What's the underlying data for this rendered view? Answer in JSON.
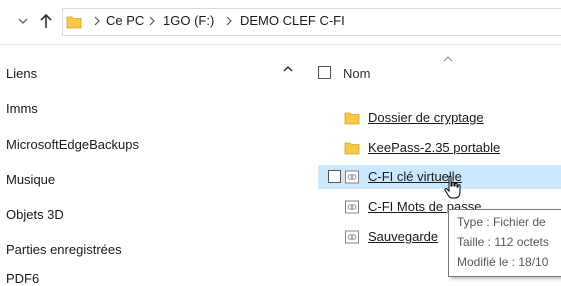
{
  "address": {
    "icons": [
      "chevron-down-icon",
      "up-arrow-icon",
      "folder-icon"
    ],
    "crumbs": [
      "Ce PC",
      "1GO (F:)",
      "DEMO CLEF C-FI"
    ]
  },
  "nav": {
    "items": [
      "Liens",
      "Imms",
      "MicrosoftEdgeBackups",
      "Musique",
      "Objets 3D",
      "Parties enregistrées",
      "PDF6"
    ]
  },
  "list": {
    "header": "Nom",
    "rows": [
      {
        "label": "Dossier de cryptage",
        "icon": "folder-icon"
      },
      {
        "label": "KeePass-2.35 portable",
        "icon": "folder-icon"
      },
      {
        "label": "C-FI clé virtuelle",
        "icon": "file-icon"
      },
      {
        "label": "C-FI Mots de passe",
        "icon": "file-icon"
      },
      {
        "label": "Sauvegarde",
        "icon": "file-icon"
      }
    ]
  },
  "tooltip": {
    "type": "Type : Fichier de",
    "size": "Taille : 112 octets",
    "modified": "Modifié le : 18/10"
  },
  "colors": {
    "folder": "#f6c94a",
    "hover_row": "#cce8ff",
    "accent_text": "#1a1a1a"
  }
}
